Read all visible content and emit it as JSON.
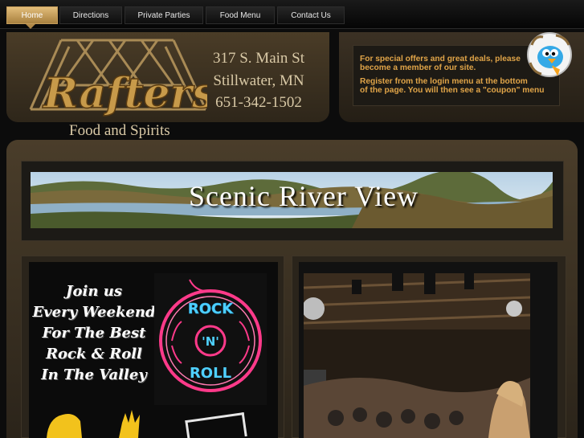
{
  "nav": {
    "items": [
      {
        "label": "Home",
        "active": true
      },
      {
        "label": "Directions",
        "active": false
      },
      {
        "label": "Private Parties",
        "active": false
      },
      {
        "label": "Food Menu",
        "active": false
      },
      {
        "label": "Contact Us",
        "active": false
      }
    ]
  },
  "header": {
    "logo_text": "Rafters",
    "tagline": "Food and Spirits",
    "address": [
      "317 S. Main St",
      "Stillwater, MN",
      "651-342-1502"
    ]
  },
  "promo": {
    "lines": [
      "For special offers and great deals, please",
      "become a member of our site.",
      "Register from the login menu at the bottom",
      "of the page. You will then see a \"coupon\" menu"
    ]
  },
  "banner": {
    "text": "Scenic River View"
  },
  "event": {
    "lines": [
      "Join us",
      "Every Weekend",
      "For The Best",
      "Rock & Roll",
      "In The Valley"
    ]
  },
  "neon_sign": {
    "top": "ROCK",
    "middle": "'N'",
    "bottom": "ROLL"
  },
  "colors": {
    "accent_gold": "#c49c5a",
    "promo_text": "#e0a448",
    "panel_brown": "#4a3d2a",
    "neon_blue": "#4fd0ff",
    "neon_pink": "#ff3a8a"
  },
  "icons": {
    "bird": "twitter-bird-icon",
    "hand": "rock-hand-icon"
  }
}
